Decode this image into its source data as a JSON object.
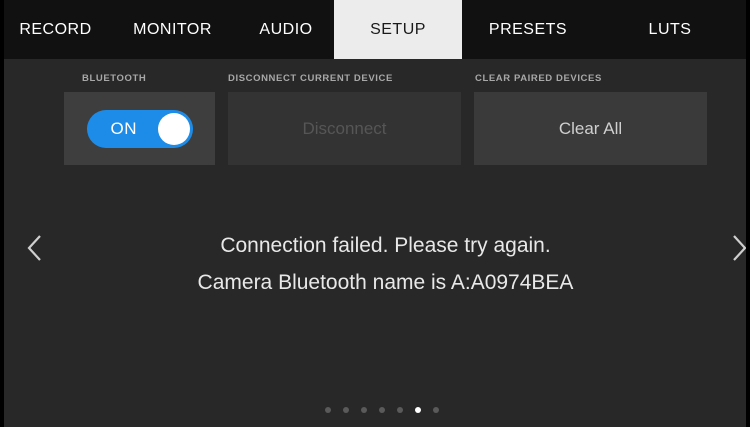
{
  "tabs": [
    {
      "label": "RECORD",
      "active": false
    },
    {
      "label": "MONITOR",
      "active": false
    },
    {
      "label": "AUDIO",
      "active": false
    },
    {
      "label": "SETUP",
      "active": true
    },
    {
      "label": "PRESETS",
      "active": false
    },
    {
      "label": "LUTS",
      "active": false
    }
  ],
  "bluetooth": {
    "label": "BLUETOOTH",
    "toggle_label": "ON",
    "enabled": true
  },
  "disconnect": {
    "label": "DISCONNECT CURRENT DEVICE",
    "button_label": "Disconnect",
    "disabled": true
  },
  "clear_paired": {
    "label": "CLEAR PAIRED DEVICES",
    "button_label": "Clear All"
  },
  "message": {
    "line1": "Connection failed. Please try again.",
    "line2": "Camera Bluetooth name is A:A0974BEA"
  },
  "pagination": {
    "total": 7,
    "current": 6
  },
  "icons": {
    "prev": "chevron-left-icon",
    "next": "chevron-right-icon"
  },
  "colors": {
    "accent": "#1d8ce8",
    "tabbar": "#111111",
    "active_tab": "#ececec",
    "background": "#282828"
  }
}
